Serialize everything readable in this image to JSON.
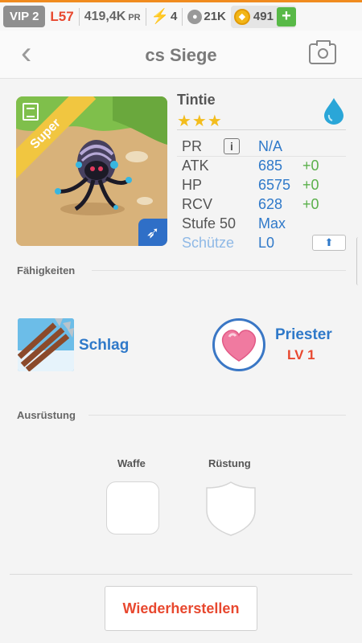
{
  "status_bar": {
    "vip": "VIP 2",
    "level": "L57",
    "power": "419,4K",
    "power_unit": "PR",
    "energy": "4",
    "pets": "21K",
    "gold": "491",
    "add": "+"
  },
  "header": {
    "title": "cs Siege"
  },
  "monster": {
    "rarity_badge": "Super",
    "name": "Tintie",
    "stars": "★★★",
    "stats": {
      "pr_label": "PR",
      "pr_value": "N/A",
      "info": "i",
      "atk_label": "ATK",
      "atk_value": "685",
      "atk_bonus": "+0",
      "hp_label": "HP",
      "hp_value": "6575",
      "hp_bonus": "+0",
      "rcv_label": "RCV",
      "rcv_value": "628",
      "rcv_bonus": "+0",
      "stufe_label": "Stufe 50",
      "stufe_value": "Max",
      "class_label": "Schütze",
      "class_value": "L0"
    }
  },
  "abilities": {
    "section_title": "Fähigkeiten",
    "skill_name": "Schlag",
    "leader_name": "Priester",
    "leader_level": "LV 1"
  },
  "equipment": {
    "section_title": "Ausrüstung",
    "weapon_label": "Waffe",
    "armor_label": "Rüstung"
  },
  "footer": {
    "restore_label": "Wiederherstellen"
  },
  "colors": {
    "accent_blue": "#2f79c9",
    "accent_red": "#e8482f",
    "bonus_green": "#5ab04a",
    "star_gold": "#f3bd1d"
  }
}
